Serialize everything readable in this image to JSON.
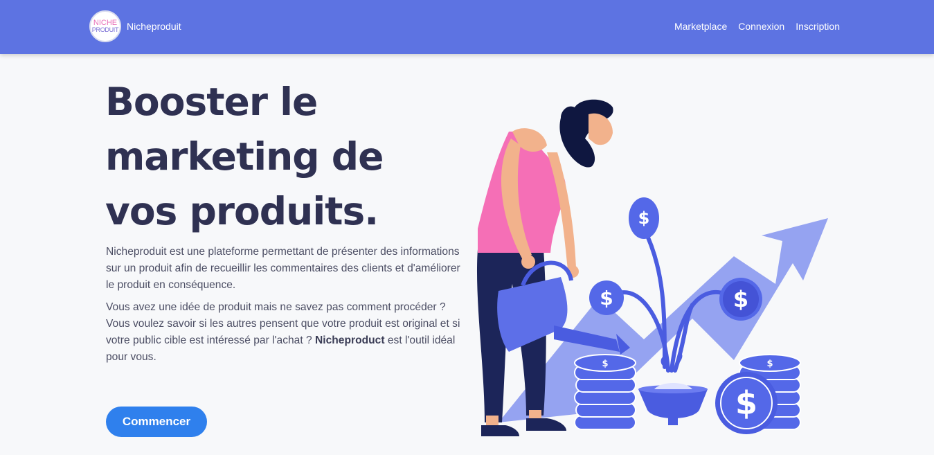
{
  "nav": {
    "logo_line1": "NICHE",
    "logo_line2": "PRODUIT",
    "brand": "Nicheproduit",
    "links": [
      "Marketplace",
      "Connexion",
      "Inscription"
    ]
  },
  "hero": {
    "title": "Booster le marketing de vos produits.",
    "paragraph1": "Nicheproduit est une plateforme permettant de présenter des informations sur un produit afin de recueillir les commentaires des clients et d'améliorer le produit en conséquence.",
    "paragraph2_before": "Vous avez une idée de produit mais ne savez pas comment procéder ? Vous voulez savoir si les autres pensent que votre produit est original et si votre public cible est intéressé par l'achat ? ",
    "paragraph2_bold": "Nicheproduct",
    "paragraph2_after": " est l'outil idéal pour vous.",
    "cta": "Commencer"
  },
  "illustration": {
    "coin_symbol": "$"
  },
  "colors": {
    "navbar": "#5d73e2",
    "title": "#2f3152",
    "button": "#2f80ed",
    "arrow": "#8a99f0",
    "coin": "#5468e8",
    "shirt": "#f56fb6"
  }
}
